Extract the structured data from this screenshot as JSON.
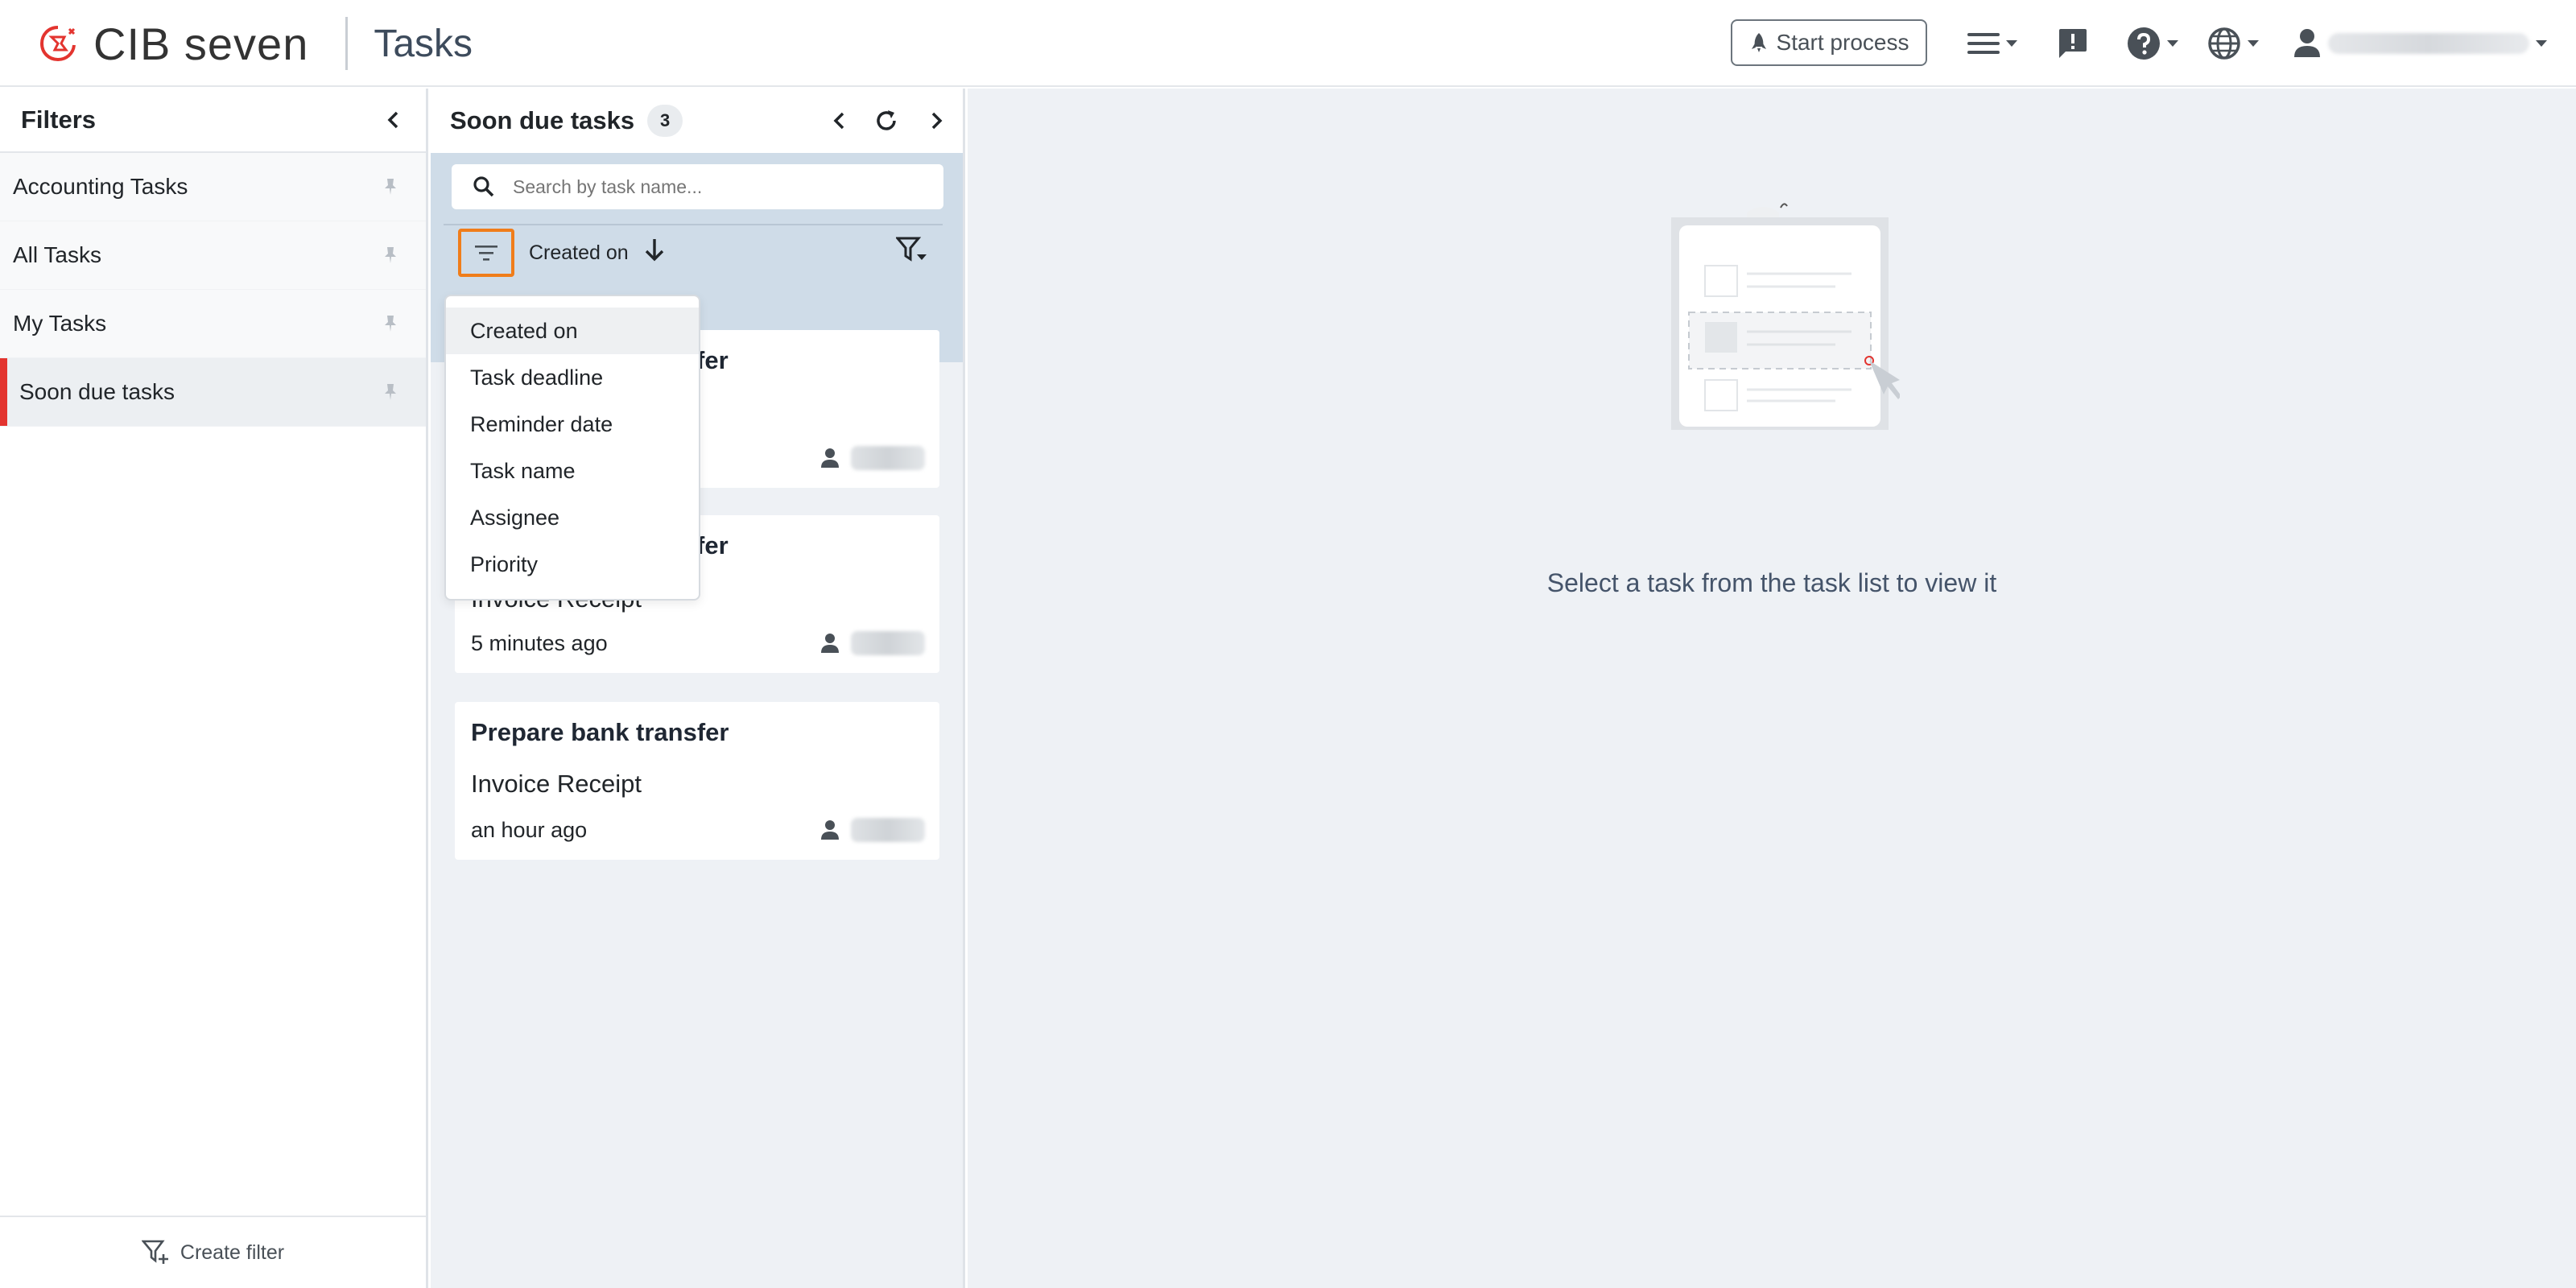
{
  "header": {
    "brand_name": "CIB seven",
    "section": "Tasks",
    "start_process_label": "Start process",
    "icons": [
      "rocket-icon",
      "hamburger-menu-icon",
      "feedback-icon",
      "help-icon",
      "globe-icon",
      "user-icon"
    ]
  },
  "sidebar": {
    "title": "Filters",
    "items": [
      {
        "label": "Accounting Tasks",
        "active": false
      },
      {
        "label": "All Tasks",
        "active": false
      },
      {
        "label": "My Tasks",
        "active": false
      },
      {
        "label": "Soon due tasks",
        "active": true
      }
    ],
    "create_filter_label": "Create filter"
  },
  "tasklist": {
    "title": "Soon due tasks",
    "count": "3",
    "search_placeholder": "Search by task name...",
    "sort_label": "Created on",
    "sort_menu": {
      "options": [
        "Created on",
        "Task deadline",
        "Reminder date",
        "Task name",
        "Assignee",
        "Priority"
      ],
      "selected": "Created on"
    },
    "tasks": [
      {
        "title_visible": "fer",
        "process": "",
        "time": ""
      },
      {
        "title_visible": "fer",
        "process": "Invoice Receipt",
        "time": "5 minutes ago"
      },
      {
        "title": "Prepare bank transfer",
        "process": "Invoice Receipt",
        "time": "an hour ago"
      }
    ]
  },
  "main": {
    "empty_message": "Select a task from the task list to view it"
  },
  "colors": {
    "accent_red": "#e3342f",
    "highlight_orange": "#f07d1a",
    "toolbar_blue": "#cfdce8",
    "panel_bg": "#eef1f5"
  }
}
